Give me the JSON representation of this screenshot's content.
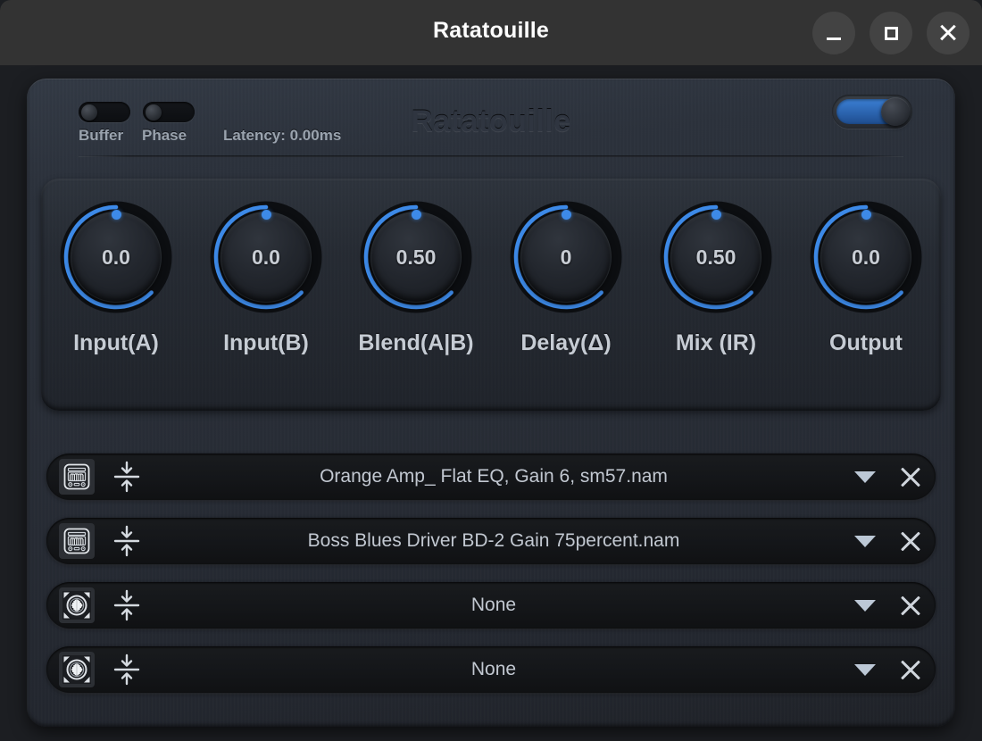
{
  "window": {
    "title": "Ratatouille",
    "controls": {
      "minimize": "minimize-icon",
      "maximize": "maximize-icon",
      "close": "close-icon"
    }
  },
  "plugin": {
    "brand": "Ratatouille",
    "header": {
      "buffer_label": "Buffer",
      "buffer_state": "off",
      "phase_label": "Phase",
      "phase_state": "off",
      "latency_text": "Latency: 0.00ms",
      "master_state": "on"
    },
    "knobs": [
      {
        "label": "Input(A)",
        "value": "0.0",
        "arc_pct": 50
      },
      {
        "label": "Input(B)",
        "value": "0.0",
        "arc_pct": 50
      },
      {
        "label": "Blend(A|B)",
        "value": "0.50",
        "arc_pct": 50
      },
      {
        "label": "Delay(Δ)",
        "value": "0",
        "arc_pct": 50
      },
      {
        "label": "Mix (IR)",
        "value": "0.50",
        "arc_pct": 50
      },
      {
        "label": "Output",
        "value": "0.0",
        "arc_pct": 50
      }
    ],
    "slots": [
      {
        "icon": "amp-icon",
        "name": "Orange Amp_ Flat EQ, Gain 6, sm57.nam",
        "caret": "chevron-down-icon",
        "close": "clear-icon",
        "normalize": "normalize-icon"
      },
      {
        "icon": "amp-icon",
        "name": "Boss Blues Driver BD-2 Gain 75percent.nam",
        "caret": "chevron-down-icon",
        "close": "clear-icon",
        "normalize": "normalize-icon"
      },
      {
        "icon": "speaker-icon",
        "name": "None",
        "caret": "chevron-down-icon",
        "close": "clear-icon",
        "normalize": "normalize-icon"
      },
      {
        "icon": "speaker-icon",
        "name": "None",
        "caret": "chevron-down-icon",
        "close": "clear-icon",
        "normalize": "normalize-icon"
      }
    ]
  },
  "colors": {
    "accent_blue": "#3d8ae8",
    "panel_bg": "#282d36",
    "titlebar_bg": "#333333",
    "text_primary": "#c6ccd4",
    "text_muted": "#9aa3ae"
  }
}
